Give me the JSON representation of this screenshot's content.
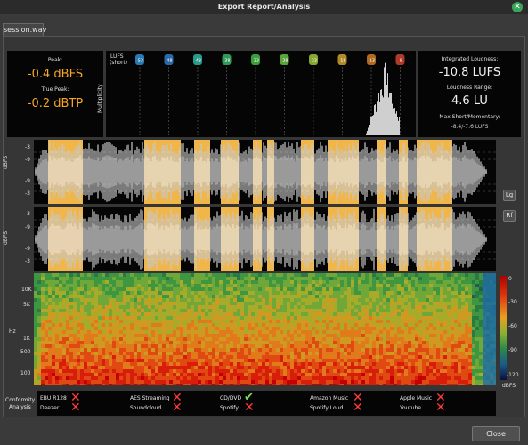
{
  "window": {
    "title": "Export Report/Analysis"
  },
  "tab": {
    "label": "session.wav"
  },
  "peak": {
    "label": "Peak:",
    "value": "-0.4 dBFS",
    "true_peak_label": "True Peak:",
    "true_peak_value": "-0.2 dBTP"
  },
  "histogram": {
    "lufs_label": "LUFS",
    "lufs_sub": "(short)",
    "multiplicity_label": "Multiplicity",
    "markers": [
      "-53",
      "-48",
      "-43",
      "-38",
      "-33",
      "-28",
      "-23",
      "-18",
      "-13",
      "-8"
    ],
    "marker_colors": [
      "#2a7ab0",
      "#2a6aa8",
      "#2a9a8a",
      "#2f9a5a",
      "#3c9e3c",
      "#5aa33a",
      "#86a832",
      "#b08a2a",
      "#b06a22",
      "#b03a2a"
    ]
  },
  "loudness": {
    "integrated_label": "Integrated Loudness:",
    "integrated_value": "-10.8 LUFS",
    "range_label": "Loudness Range:",
    "range_value": "4.6 LU",
    "max_label": "Max Short/Momentary:",
    "max_value": "-8.4/-7.6 LUFS"
  },
  "waveform": {
    "top_ticks": [
      "-3",
      "-9",
      "-9",
      "-3"
    ],
    "bottom_ticks": [
      "-3",
      "-9",
      "-9",
      "-3"
    ],
    "unit": "dBFS",
    "log_button": "Lg",
    "rect_button": "Rf"
  },
  "spectrogram": {
    "freq_ticks": [
      "10K",
      "5K",
      "1K",
      "500",
      "100"
    ],
    "axis_label": "Hz",
    "scale_ticks": [
      "0",
      "-30",
      "-60",
      "-90",
      "-120"
    ],
    "scale_unit": "dBFS"
  },
  "conformity": {
    "label1": "Conformity",
    "label2": "Analysis",
    "items": [
      {
        "name": "EBU R128",
        "ok": false
      },
      {
        "name": "Deezer",
        "ok": false
      },
      {
        "name": "AES Streaming",
        "ok": false
      },
      {
        "name": "Soundcloud",
        "ok": false
      },
      {
        "name": "CD/DVD",
        "ok": true
      },
      {
        "name": "Spotify",
        "ok": false
      },
      {
        "name": "Amazon Music",
        "ok": false
      },
      {
        "name": "Spotify Loud",
        "ok": false
      },
      {
        "name": "Apple Music",
        "ok": false
      },
      {
        "name": "Youtube",
        "ok": false
      }
    ]
  },
  "footer": {
    "close_label": "Close"
  }
}
